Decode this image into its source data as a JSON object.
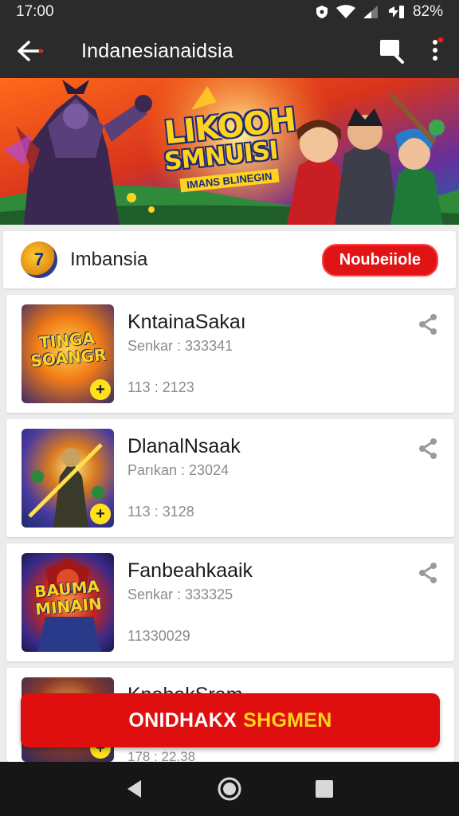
{
  "status_bar": {
    "time": "17:00",
    "battery": "82%",
    "icons": [
      "shield-icon",
      "wifi-icon",
      "signal-icon",
      "battery-icon"
    ]
  },
  "app_bar": {
    "title": "Indanesianaidsia",
    "icons": [
      "back-arrow-icon",
      "cast-icon",
      "more-vert-icon"
    ]
  },
  "banner": {
    "title_line1": "LIKOOH",
    "title_line2": "SMNUISI",
    "subtitle": "IMANS BLINEGIN"
  },
  "channel": {
    "name": "Imbansia",
    "button_label": "Noubeiiole",
    "logo_letter": "7"
  },
  "videos": [
    {
      "title": "KntainaSakaı",
      "subtitle": "Senkar : 333341",
      "meta": "113 : 2123",
      "thumb_text": "TINGA SOANGR",
      "badge": "+"
    },
    {
      "title": "DlanalNsaak",
      "subtitle": "Parıkan : 23024",
      "meta": "113 : 3128",
      "thumb_text": "",
      "badge": "+"
    },
    {
      "title": "Fanbeahkaaik",
      "subtitle": "Senkar : 333325",
      "meta": "11330029",
      "thumb_text": "BAUMA MINAIN",
      "badge": ""
    },
    {
      "title": "KnahakSram",
      "subtitle": "",
      "meta": "178 : 22.38",
      "thumb_text": "",
      "badge": "+"
    }
  ],
  "cta": {
    "label_main": "ONIDHAKX",
    "label_accent": "SHGMEN"
  },
  "colors": {
    "bar": "#2b2b2b",
    "accent_red": "#df0f0f",
    "accent_yellow": "#ffd21f"
  }
}
